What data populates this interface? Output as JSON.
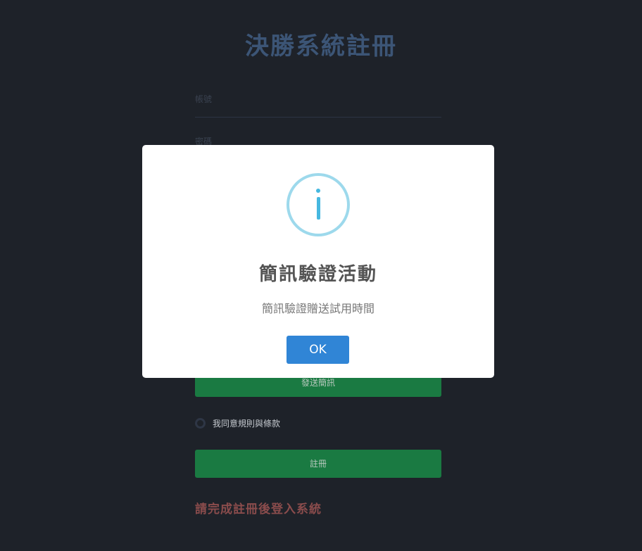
{
  "page": {
    "title": "決勝系統註冊",
    "fields": {
      "account_placeholder": "帳號",
      "password_placeholder": "密碼"
    },
    "send_sms_label": "發送簡訊",
    "agree_label": "我同意規則與條款",
    "register_label": "註冊",
    "login_hint": "請完成註冊後登入系統"
  },
  "modal": {
    "icon": "info-icon",
    "title": "簡訊驗證活動",
    "text": "簡訊驗證贈送試用時間",
    "ok_label": "OK"
  },
  "colors": {
    "background": "#1e2229",
    "title": "#3c5576",
    "green_button": "#1a7a42",
    "ok_button": "#3085d6",
    "info_ring": "#9dd9ec",
    "info_glyph": "#46b8e0",
    "login_hint": "#8a4c4c"
  }
}
